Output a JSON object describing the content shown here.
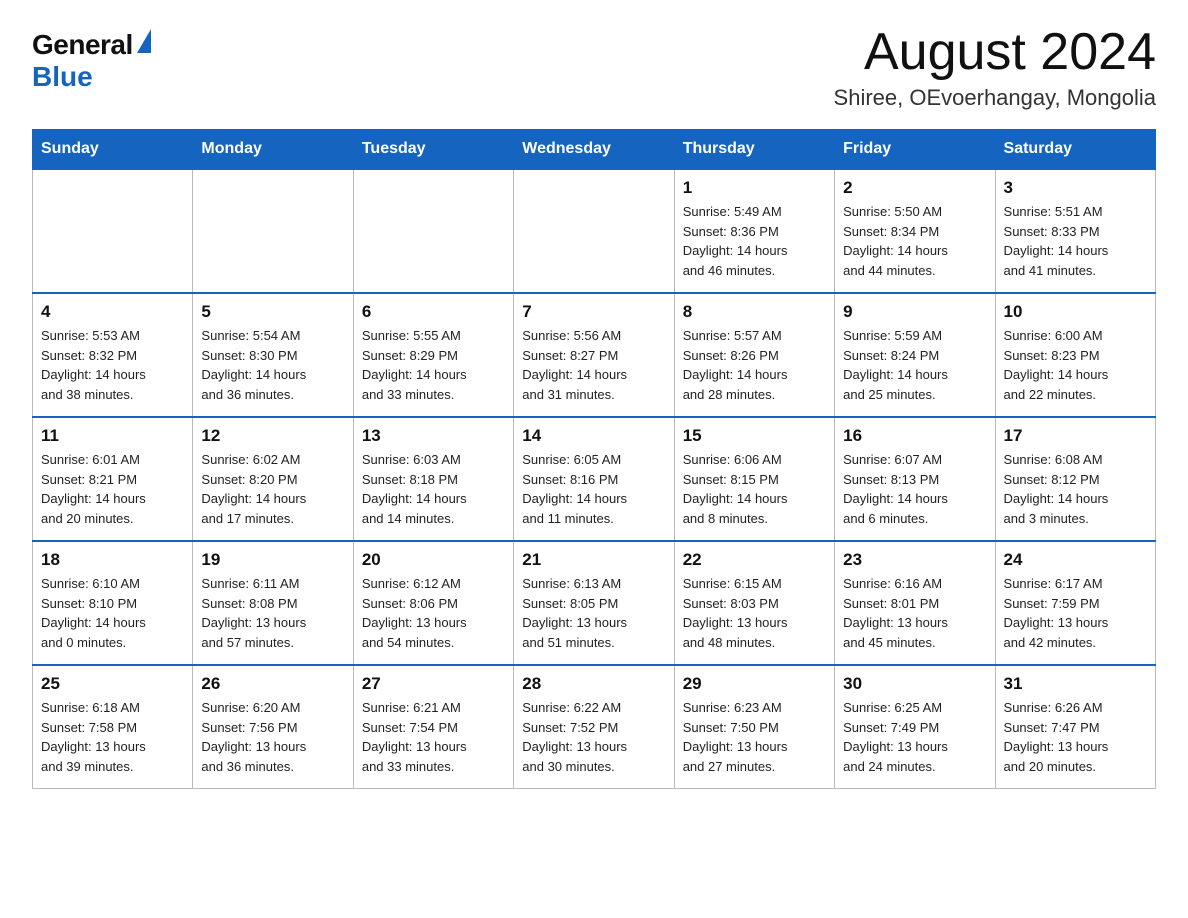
{
  "logo": {
    "general": "General",
    "blue": "Blue"
  },
  "title": "August 2024",
  "location": "Shiree, OEvoerhangay, Mongolia",
  "days_of_week": [
    "Sunday",
    "Monday",
    "Tuesday",
    "Wednesday",
    "Thursday",
    "Friday",
    "Saturday"
  ],
  "weeks": [
    [
      {
        "day": "",
        "info": ""
      },
      {
        "day": "",
        "info": ""
      },
      {
        "day": "",
        "info": ""
      },
      {
        "day": "",
        "info": ""
      },
      {
        "day": "1",
        "info": "Sunrise: 5:49 AM\nSunset: 8:36 PM\nDaylight: 14 hours\nand 46 minutes."
      },
      {
        "day": "2",
        "info": "Sunrise: 5:50 AM\nSunset: 8:34 PM\nDaylight: 14 hours\nand 44 minutes."
      },
      {
        "day": "3",
        "info": "Sunrise: 5:51 AM\nSunset: 8:33 PM\nDaylight: 14 hours\nand 41 minutes."
      }
    ],
    [
      {
        "day": "4",
        "info": "Sunrise: 5:53 AM\nSunset: 8:32 PM\nDaylight: 14 hours\nand 38 minutes."
      },
      {
        "day": "5",
        "info": "Sunrise: 5:54 AM\nSunset: 8:30 PM\nDaylight: 14 hours\nand 36 minutes."
      },
      {
        "day": "6",
        "info": "Sunrise: 5:55 AM\nSunset: 8:29 PM\nDaylight: 14 hours\nand 33 minutes."
      },
      {
        "day": "7",
        "info": "Sunrise: 5:56 AM\nSunset: 8:27 PM\nDaylight: 14 hours\nand 31 minutes."
      },
      {
        "day": "8",
        "info": "Sunrise: 5:57 AM\nSunset: 8:26 PM\nDaylight: 14 hours\nand 28 minutes."
      },
      {
        "day": "9",
        "info": "Sunrise: 5:59 AM\nSunset: 8:24 PM\nDaylight: 14 hours\nand 25 minutes."
      },
      {
        "day": "10",
        "info": "Sunrise: 6:00 AM\nSunset: 8:23 PM\nDaylight: 14 hours\nand 22 minutes."
      }
    ],
    [
      {
        "day": "11",
        "info": "Sunrise: 6:01 AM\nSunset: 8:21 PM\nDaylight: 14 hours\nand 20 minutes."
      },
      {
        "day": "12",
        "info": "Sunrise: 6:02 AM\nSunset: 8:20 PM\nDaylight: 14 hours\nand 17 minutes."
      },
      {
        "day": "13",
        "info": "Sunrise: 6:03 AM\nSunset: 8:18 PM\nDaylight: 14 hours\nand 14 minutes."
      },
      {
        "day": "14",
        "info": "Sunrise: 6:05 AM\nSunset: 8:16 PM\nDaylight: 14 hours\nand 11 minutes."
      },
      {
        "day": "15",
        "info": "Sunrise: 6:06 AM\nSunset: 8:15 PM\nDaylight: 14 hours\nand 8 minutes."
      },
      {
        "day": "16",
        "info": "Sunrise: 6:07 AM\nSunset: 8:13 PM\nDaylight: 14 hours\nand 6 minutes."
      },
      {
        "day": "17",
        "info": "Sunrise: 6:08 AM\nSunset: 8:12 PM\nDaylight: 14 hours\nand 3 minutes."
      }
    ],
    [
      {
        "day": "18",
        "info": "Sunrise: 6:10 AM\nSunset: 8:10 PM\nDaylight: 14 hours\nand 0 minutes."
      },
      {
        "day": "19",
        "info": "Sunrise: 6:11 AM\nSunset: 8:08 PM\nDaylight: 13 hours\nand 57 minutes."
      },
      {
        "day": "20",
        "info": "Sunrise: 6:12 AM\nSunset: 8:06 PM\nDaylight: 13 hours\nand 54 minutes."
      },
      {
        "day": "21",
        "info": "Sunrise: 6:13 AM\nSunset: 8:05 PM\nDaylight: 13 hours\nand 51 minutes."
      },
      {
        "day": "22",
        "info": "Sunrise: 6:15 AM\nSunset: 8:03 PM\nDaylight: 13 hours\nand 48 minutes."
      },
      {
        "day": "23",
        "info": "Sunrise: 6:16 AM\nSunset: 8:01 PM\nDaylight: 13 hours\nand 45 minutes."
      },
      {
        "day": "24",
        "info": "Sunrise: 6:17 AM\nSunset: 7:59 PM\nDaylight: 13 hours\nand 42 minutes."
      }
    ],
    [
      {
        "day": "25",
        "info": "Sunrise: 6:18 AM\nSunset: 7:58 PM\nDaylight: 13 hours\nand 39 minutes."
      },
      {
        "day": "26",
        "info": "Sunrise: 6:20 AM\nSunset: 7:56 PM\nDaylight: 13 hours\nand 36 minutes."
      },
      {
        "day": "27",
        "info": "Sunrise: 6:21 AM\nSunset: 7:54 PM\nDaylight: 13 hours\nand 33 minutes."
      },
      {
        "day": "28",
        "info": "Sunrise: 6:22 AM\nSunset: 7:52 PM\nDaylight: 13 hours\nand 30 minutes."
      },
      {
        "day": "29",
        "info": "Sunrise: 6:23 AM\nSunset: 7:50 PM\nDaylight: 13 hours\nand 27 minutes."
      },
      {
        "day": "30",
        "info": "Sunrise: 6:25 AM\nSunset: 7:49 PM\nDaylight: 13 hours\nand 24 minutes."
      },
      {
        "day": "31",
        "info": "Sunrise: 6:26 AM\nSunset: 7:47 PM\nDaylight: 13 hours\nand 20 minutes."
      }
    ]
  ]
}
